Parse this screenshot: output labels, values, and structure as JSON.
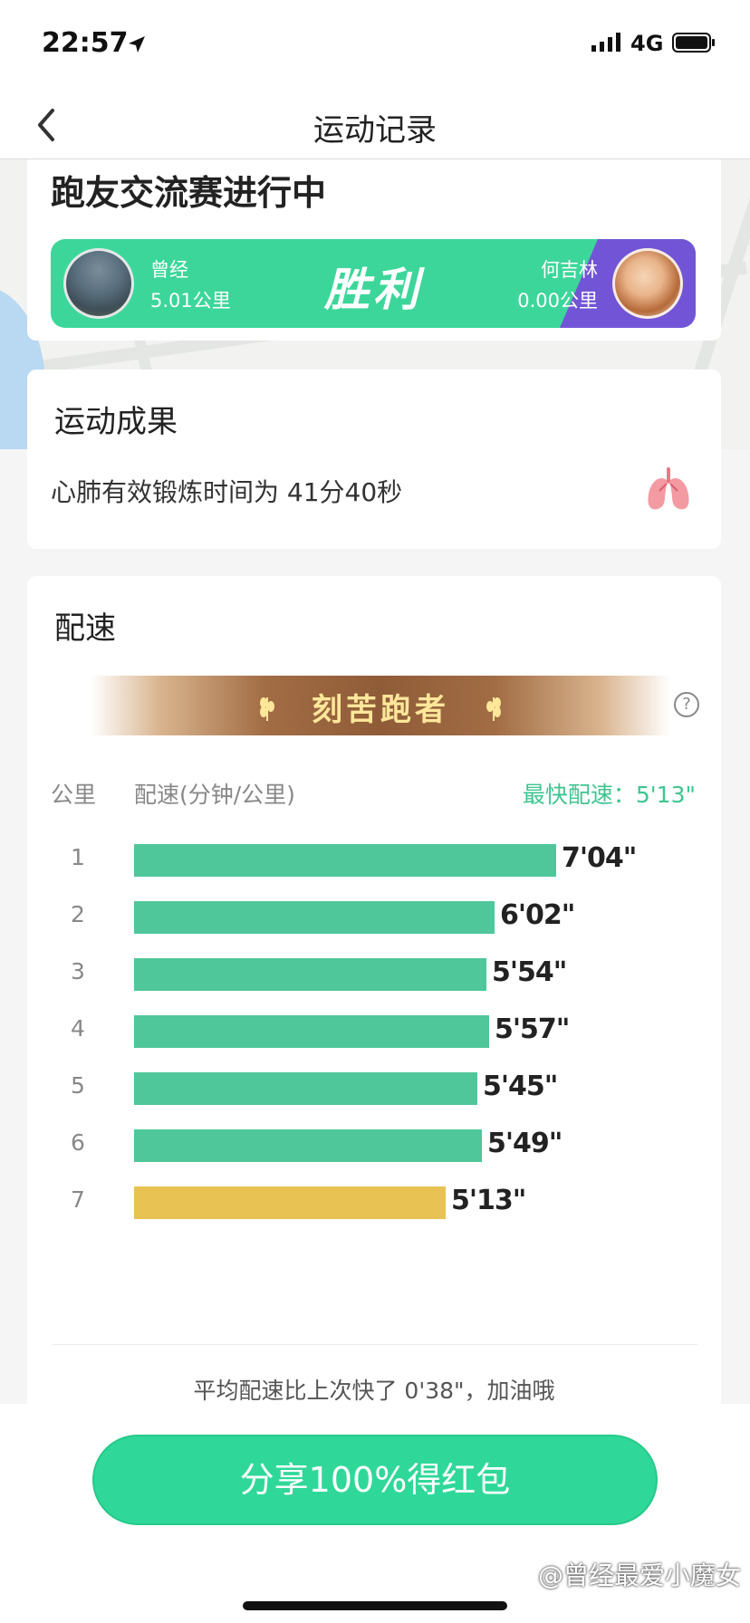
{
  "status_bar": {
    "time": "22:57",
    "network": "4G"
  },
  "nav": {
    "title": "运动记录"
  },
  "contest": {
    "title": "跑友交流赛进行中",
    "left_player": {
      "name": "曾经",
      "distance": "5.01公里"
    },
    "result": "胜利",
    "right_player": {
      "name": "何吉林",
      "distance": "0.00公里"
    }
  },
  "results": {
    "title": "运动成果",
    "cardio_text": "心肺有效锻炼时间为 41分40秒"
  },
  "pace": {
    "title": "配速",
    "badge": "刻苦跑者",
    "col_km": "公里",
    "col_pace": "配速(分钟/公里)",
    "fastest_label": "最快配速：5'13\"",
    "rows": [
      {
        "km": "1",
        "value": "7'04\"",
        "seconds": 424
      },
      {
        "km": "2",
        "value": "6'02\"",
        "seconds": 362
      },
      {
        "km": "3",
        "value": "5'54\"",
        "seconds": 354
      },
      {
        "km": "4",
        "value": "5'57\"",
        "seconds": 357
      },
      {
        "km": "5",
        "value": "5'45\"",
        "seconds": 345
      },
      {
        "km": "6",
        "value": "5'49\"",
        "seconds": 349
      },
      {
        "km": "7",
        "value": "5'13\"",
        "seconds": 313
      }
    ],
    "compare_text": "平均配速比上次快了 0'38\"，加油哦"
  },
  "share": {
    "button_label": "分享100%得红包"
  },
  "watermark": "@曾经最爱小魔女",
  "colors": {
    "brand_green": "#3dd69a",
    "bar_green": "#4fc79a",
    "bar_fastest": "#e8c353",
    "opponent_purple": "#7255d6"
  }
}
